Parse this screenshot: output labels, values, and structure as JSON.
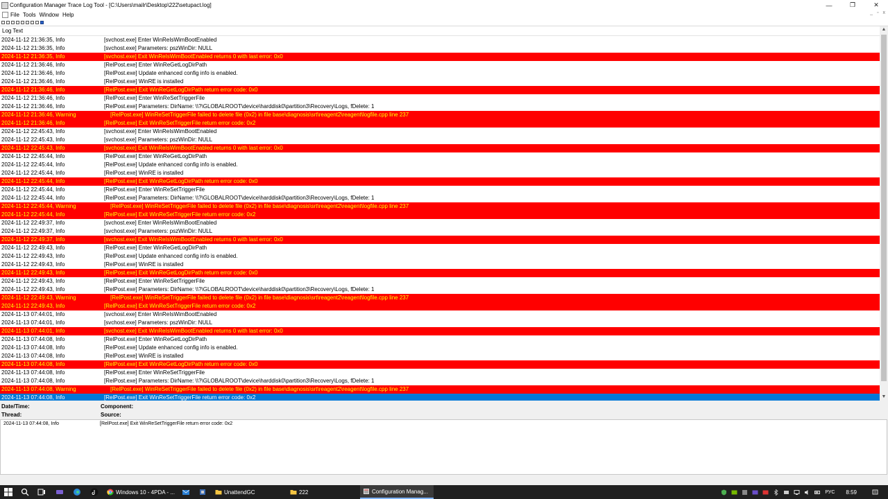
{
  "window": {
    "title": "Configuration Manager Trace Log Tool - [C:\\Users\\mailr\\Desktop\\222\\setupact.log]",
    "minimize": "—",
    "maximize": "❐",
    "close": "✕"
  },
  "menu": {
    "items": [
      "File",
      "Tools",
      "Window",
      "Help"
    ],
    "mdi": [
      "_",
      "▫",
      "x"
    ]
  },
  "log": {
    "header": "Log Text",
    "rows": [
      {
        "dt": "2024-11-12 21:36:35, Info",
        "text": "[svchost.exe] Enter WinReIsWimBootEnabled",
        "type": "info"
      },
      {
        "dt": "2024-11-12 21:36:35, Info",
        "text": "[svchost.exe] Parameters: pszWinDir: NULL",
        "type": "info"
      },
      {
        "dt": "2024-11-12 21:36:35, Info",
        "text": "[svchost.exe] Exit WinReIsWimBootEnabled returns 0 with last error: 0x0",
        "type": "error"
      },
      {
        "dt": "2024-11-12 21:36:46, Info",
        "text": "[RelPost.exe] Enter WinReGetLogDirPath",
        "type": "info"
      },
      {
        "dt": "2024-11-12 21:36:46, Info",
        "text": "[RelPost.exe] Update enhanced config info is enabled.",
        "type": "info"
      },
      {
        "dt": "2024-11-12 21:36:46, Info",
        "text": "[RelPost.exe] WinRE is installed",
        "type": "info"
      },
      {
        "dt": "2024-11-12 21:36:46, Info",
        "text": "[RelPost.exe] Exit WinReGetLogDirPath return error code: 0x0",
        "type": "error"
      },
      {
        "dt": "2024-11-12 21:36:46, Info",
        "text": "[RelPost.exe] Enter WinReSetTriggerFile",
        "type": "info"
      },
      {
        "dt": "2024-11-12 21:36:46, Info",
        "text": "[RelPost.exe] Parameters: DirName: \\\\?\\GLOBALROOT\\device\\harddisk0\\partition3\\Recovery\\Logs, fDelete: 1",
        "type": "info"
      },
      {
        "dt": "2024-11-12 21:36:46, Warning",
        "text": "[RelPost.exe] WinReSetTriggerFile failed to delete file (0x2) in file base\\diagnosis\\srt\\reagent2\\reagent\\logfile.cpp line 237",
        "type": "warning"
      },
      {
        "dt": "2024-11-12 21:36:46, Info",
        "text": "[RelPost.exe] Exit WinReSetTriggerFile return error code: 0x2",
        "type": "error"
      },
      {
        "dt": "2024-11-12 22:45:43, Info",
        "text": "[svchost.exe] Enter WinReIsWimBootEnabled",
        "type": "info"
      },
      {
        "dt": "2024-11-12 22:45:43, Info",
        "text": "[svchost.exe] Parameters: pszWinDir: NULL",
        "type": "info"
      },
      {
        "dt": "2024-11-12 22:45:43, Info",
        "text": "[svchost.exe] Exit WinReIsWimBootEnabled returns 0 with last error: 0x0",
        "type": "error"
      },
      {
        "dt": "2024-11-12 22:45:44, Info",
        "text": "[RelPost.exe] Enter WinReGetLogDirPath",
        "type": "info"
      },
      {
        "dt": "2024-11-12 22:45:44, Info",
        "text": "[RelPost.exe] Update enhanced config info is enabled.",
        "type": "info"
      },
      {
        "dt": "2024-11-12 22:45:44, Info",
        "text": "[RelPost.exe] WinRE is installed",
        "type": "info"
      },
      {
        "dt": "2024-11-12 22:45:44, Info",
        "text": "[RelPost.exe] Exit WinReGetLogDirPath return error code: 0x0",
        "type": "error"
      },
      {
        "dt": "2024-11-12 22:45:44, Info",
        "text": "[RelPost.exe] Enter WinReSetTriggerFile",
        "type": "info"
      },
      {
        "dt": "2024-11-12 22:45:44, Info",
        "text": "[RelPost.exe] Parameters: DirName: \\\\?\\GLOBALROOT\\device\\harddisk0\\partition3\\Recovery\\Logs, fDelete: 1",
        "type": "info"
      },
      {
        "dt": "2024-11-12 22:45:44, Warning",
        "text": "[RelPost.exe] WinReSetTriggerFile failed to delete file (0x2) in file base\\diagnosis\\srt\\reagent2\\reagent\\logfile.cpp line 237",
        "type": "warning"
      },
      {
        "dt": "2024-11-12 22:45:44, Info",
        "text": "[RelPost.exe] Exit WinReSetTriggerFile return error code: 0x2",
        "type": "error"
      },
      {
        "dt": "2024-11-12 22:49:37, Info",
        "text": "[svchost.exe] Enter WinReIsWimBootEnabled",
        "type": "info"
      },
      {
        "dt": "2024-11-12 22:49:37, Info",
        "text": "[svchost.exe] Parameters: pszWinDir: NULL",
        "type": "info"
      },
      {
        "dt": "2024-11-12 22:49:37, Info",
        "text": "[svchost.exe] Exit WinReIsWimBootEnabled returns 0 with last error: 0x0",
        "type": "error"
      },
      {
        "dt": "2024-11-12 22:49:43, Info",
        "text": "[RelPost.exe] Enter WinReGetLogDirPath",
        "type": "info"
      },
      {
        "dt": "2024-11-12 22:49:43, Info",
        "text": "[RelPost.exe] Update enhanced config info is enabled.",
        "type": "info"
      },
      {
        "dt": "2024-11-12 22:49:43, Info",
        "text": "[RelPost.exe] WinRE is installed",
        "type": "info"
      },
      {
        "dt": "2024-11-12 22:49:43, Info",
        "text": "[RelPost.exe] Exit WinReGetLogDirPath return error code: 0x0",
        "type": "error"
      },
      {
        "dt": "2024-11-12 22:49:43, Info",
        "text": "[RelPost.exe] Enter WinReSetTriggerFile",
        "type": "info"
      },
      {
        "dt": "2024-11-12 22:49:43, Info",
        "text": "[RelPost.exe] Parameters: DirName: \\\\?\\GLOBALROOT\\device\\harddisk0\\partition3\\Recovery\\Logs, fDelete: 1",
        "type": "info"
      },
      {
        "dt": "2024-11-12 22:49:43, Warning",
        "text": "[RelPost.exe] WinReSetTriggerFile failed to delete file (0x2) in file base\\diagnosis\\srt\\reagent2\\reagent\\logfile.cpp line 237",
        "type": "warning"
      },
      {
        "dt": "2024-11-12 22:49:43, Info",
        "text": "[RelPost.exe] Exit WinReSetTriggerFile return error code: 0x2",
        "type": "error"
      },
      {
        "dt": "2024-11-13 07:44:01, Info",
        "text": "[svchost.exe] Enter WinReIsWimBootEnabled",
        "type": "info"
      },
      {
        "dt": "2024-11-13 07:44:01, Info",
        "text": "[svchost.exe] Parameters: pszWinDir: NULL",
        "type": "info"
      },
      {
        "dt": "2024-11-13 07:44:01, Info",
        "text": "[svchost.exe] Exit WinReIsWimBootEnabled returns 0 with last error: 0x0",
        "type": "error"
      },
      {
        "dt": "2024-11-13 07:44:08, Info",
        "text": "[RelPost.exe] Enter WinReGetLogDirPath",
        "type": "info"
      },
      {
        "dt": "2024-11-13 07:44:08, Info",
        "text": "[RelPost.exe] Update enhanced config info is enabled.",
        "type": "info"
      },
      {
        "dt": "2024-11-13 07:44:08, Info",
        "text": "[RelPost.exe] WinRE is installed",
        "type": "info"
      },
      {
        "dt": "2024-11-13 07:44:08, Info",
        "text": "[RelPost.exe] Exit WinReGetLogDirPath return error code: 0x0",
        "type": "error"
      },
      {
        "dt": "2024-11-13 07:44:08, Info",
        "text": "[RelPost.exe] Enter WinReSetTriggerFile",
        "type": "info"
      },
      {
        "dt": "2024-11-13 07:44:08, Info",
        "text": "[RelPost.exe] Parameters: DirName: \\\\?\\GLOBALROOT\\device\\harddisk0\\partition3\\Recovery\\Logs, fDelete: 1",
        "type": "info"
      },
      {
        "dt": "2024-11-13 07:44:08, Warning",
        "text": "[RelPost.exe] WinReSetTriggerFile failed to delete file (0x2) in file base\\diagnosis\\srt\\reagent2\\reagent\\logfile.cpp line 237",
        "type": "warning"
      },
      {
        "dt": "2024-11-13 07:44:08, Info",
        "text": "[RelPost.exe] Exit WinReSetTriggerFile return error code: 0x2",
        "type": "selected"
      }
    ]
  },
  "details": {
    "datetime_label": "Date/Time:",
    "component_label": "Component:",
    "thread_label": "Thread:",
    "source_label": "Source:",
    "message_datetime": "2024-11-13 07:44:08, Info",
    "message_text": "[RelPost.exe] Exit WinReSetTriggerFile return error code: 0x2"
  },
  "taskbar": {
    "apps": [
      {
        "label": "Windows 10 - 4PDA - ...",
        "icon": "chrome-icon"
      },
      {
        "label": "UnattendGC",
        "icon": "folder-icon"
      },
      {
        "label": "222",
        "icon": "folder-icon"
      },
      {
        "label": "Configuration Manag...",
        "icon": "cmtrace-icon"
      }
    ],
    "lang": "РУС",
    "time": "8:59"
  },
  "colors": {
    "error_bg": "#ff0000",
    "error_fg": "#ffff00",
    "selected_bg": "#0078d7",
    "taskbar_bg": "#202020"
  }
}
